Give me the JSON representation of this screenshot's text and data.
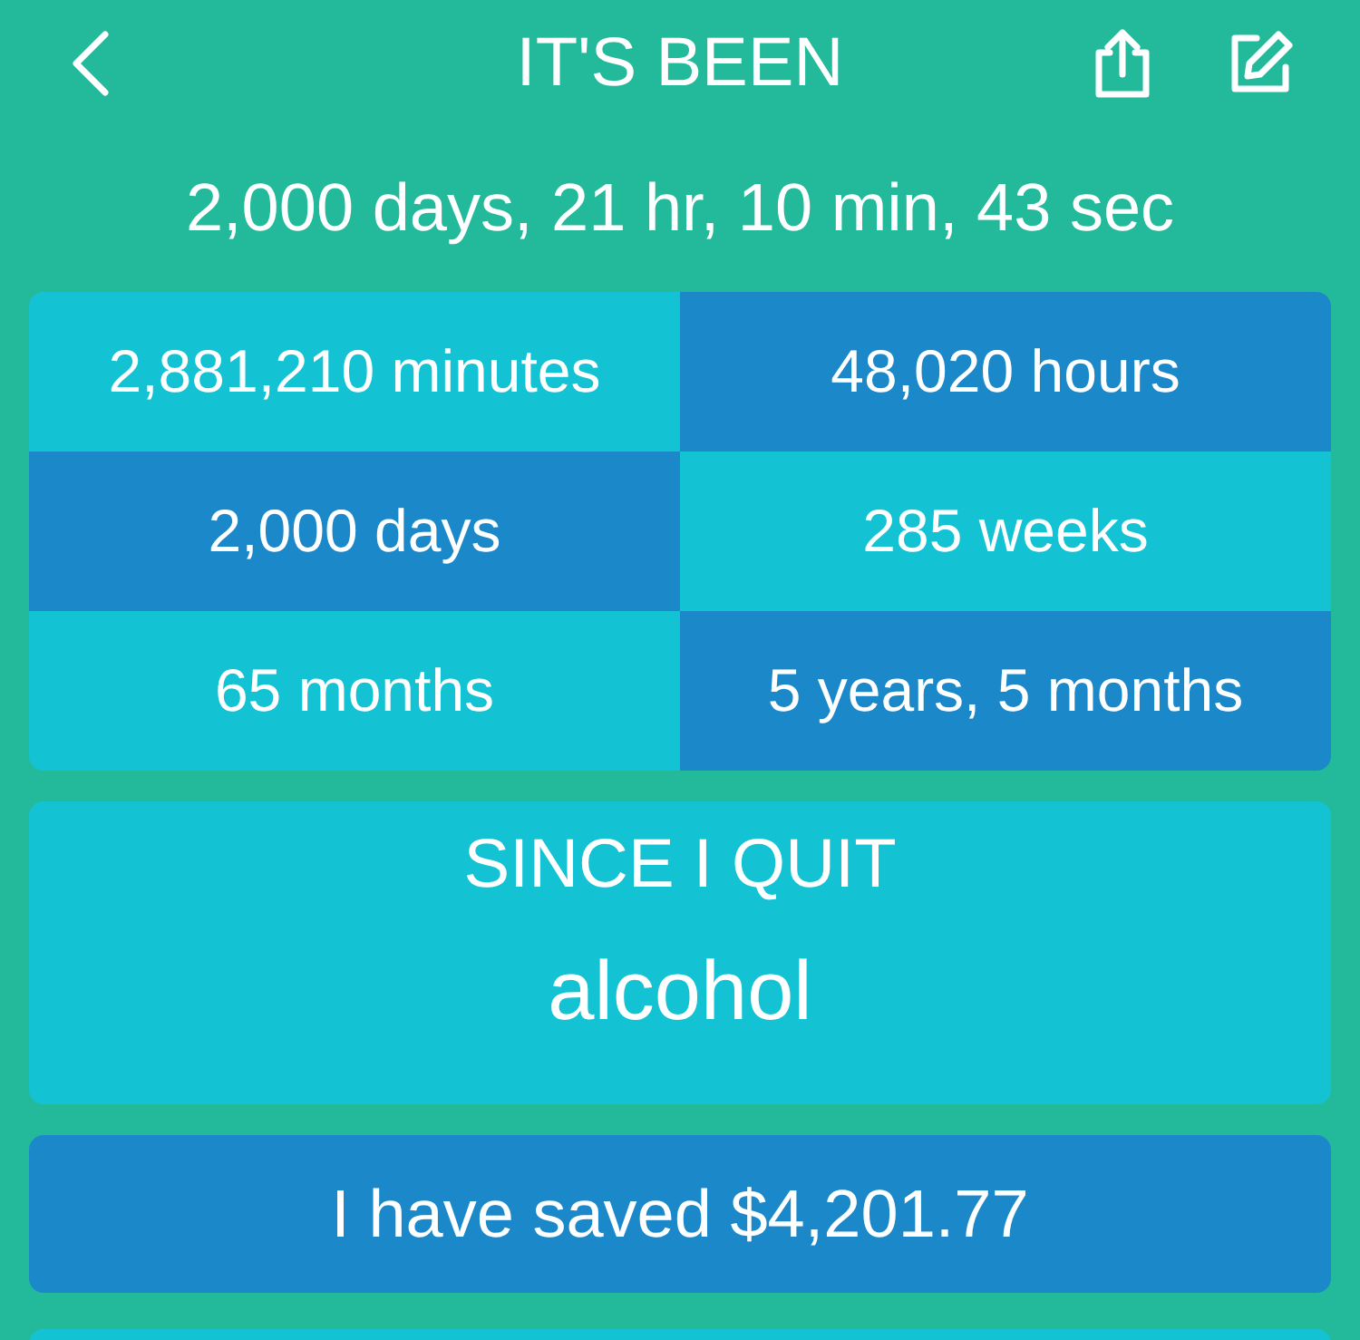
{
  "header": {
    "title": "IT'S BEEN"
  },
  "elapsed": "2,000 days, 21 hr, 10 min, 43 sec",
  "units": [
    "2,881,210 minutes",
    "48,020 hours",
    "2,000 days",
    "285 weeks",
    "65 months",
    "5 years, 5 months"
  ],
  "quit_card": {
    "heading": "SINCE I QUIT",
    "habit": "alcohol"
  },
  "savings": "I have saved $4,201.77"
}
